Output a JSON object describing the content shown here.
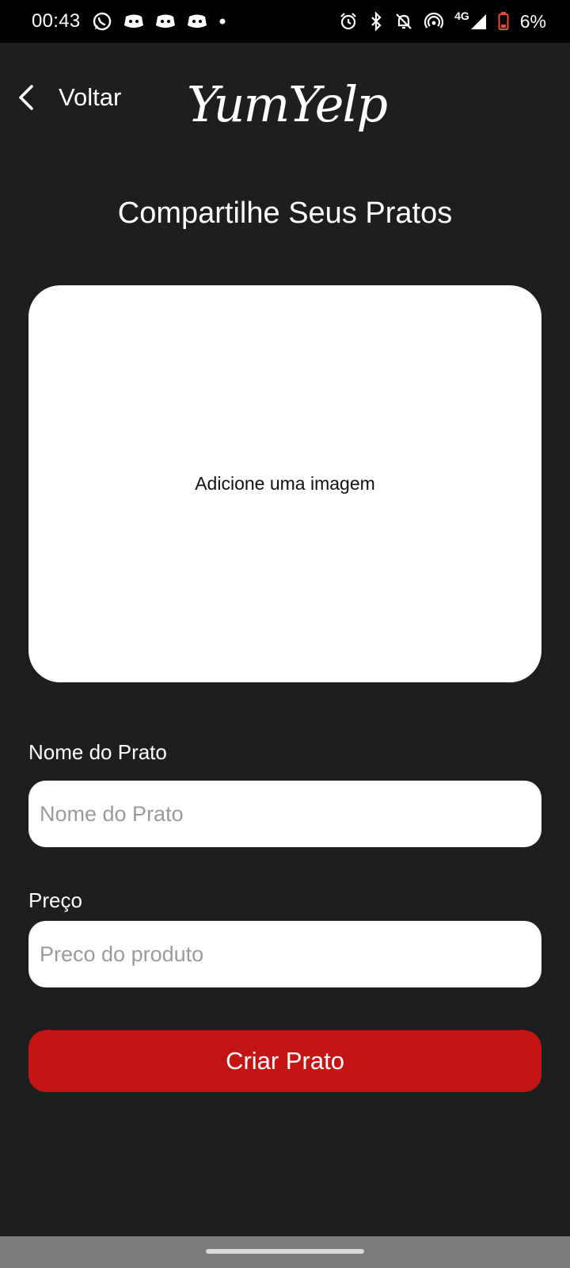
{
  "status_bar": {
    "time": "00:43",
    "left_icons": [
      "whatsapp-icon",
      "discord-icon",
      "discord-icon",
      "discord-icon",
      "dot-icon"
    ],
    "right_icons": [
      "alarm-icon",
      "bluetooth-icon",
      "mute-icon",
      "hotspot-icon"
    ],
    "network": "4G",
    "battery": "6%"
  },
  "header": {
    "back_label": "Voltar",
    "logo_text": "YumYelp"
  },
  "page": {
    "title": "Compartilhe Seus Pratos"
  },
  "image_picker": {
    "label": "Adicione uma imagem"
  },
  "form": {
    "name_label": "Nome do Prato",
    "name_placeholder": "Nome do Prato",
    "name_value": "",
    "price_label": "Preço",
    "price_placeholder": "Preco do produto",
    "price_value": "",
    "submit_label": "Criar Prato"
  },
  "colors": {
    "background": "#1f1e1e",
    "accent": "#c41515",
    "status_bar": "#000000",
    "nav_bar": "#7b7b7b"
  }
}
